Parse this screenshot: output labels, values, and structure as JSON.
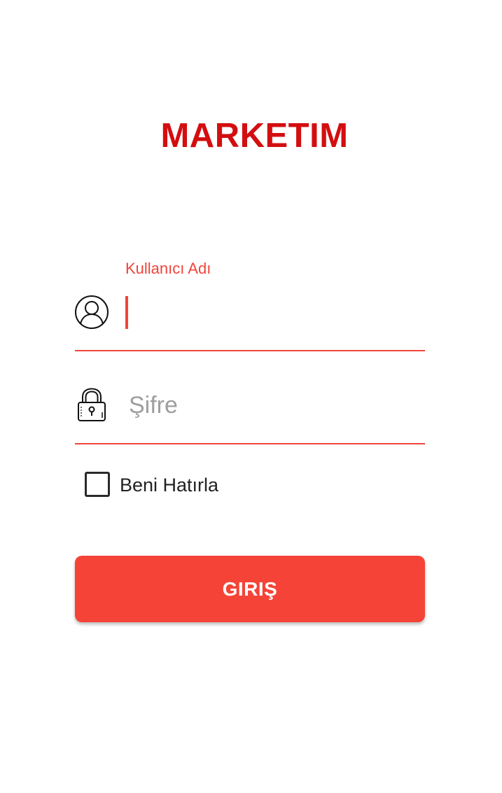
{
  "app": {
    "title": "MARKETIM",
    "brand_color": "#d30e10",
    "accent_color": "#f54337"
  },
  "login": {
    "username": {
      "label": "Kullanıcı Adı",
      "value": "",
      "icon": "user-circle-icon"
    },
    "password": {
      "placeholder": "Şifre",
      "value": "",
      "icon": "lock-icon"
    },
    "remember_me": {
      "label": "Beni Hatırla",
      "checked": false
    },
    "submit_label": "GIRIŞ"
  }
}
